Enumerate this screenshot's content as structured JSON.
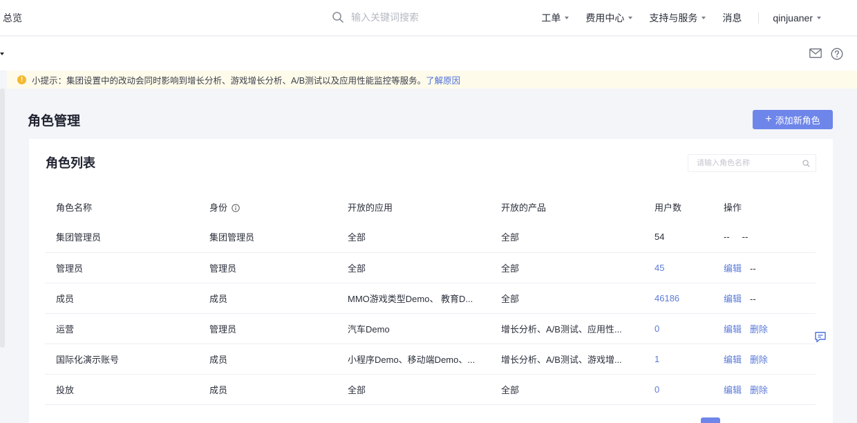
{
  "topbar": {
    "title": "总览",
    "search_placeholder": "输入关键词搜索",
    "nav": [
      {
        "label": "工单"
      },
      {
        "label": "费用中心"
      },
      {
        "label": "支持与服务"
      },
      {
        "label": "消息"
      }
    ],
    "user": "qinjuaner"
  },
  "notice": {
    "icon": "warning-icon",
    "text": "小提示：集团设置中的改动会同时影响到增长分析、游戏增长分析、A/B测试以及应用性能监控等服务。",
    "link": "了解原因"
  },
  "page": {
    "title": "角色管理",
    "add_button": "添加新角色"
  },
  "card": {
    "title": "角色列表",
    "search_placeholder": "请输入角色名称"
  },
  "table": {
    "headers": [
      "角色名称",
      "身份",
      "开放的应用",
      "开放的产品",
      "用户数",
      "操作"
    ],
    "rows": [
      {
        "name": "集团管理员",
        "identity": "集团管理员",
        "apps": "全部",
        "products": "全部",
        "users": "54",
        "op1": "--",
        "op2": "--"
      },
      {
        "name": "管理员",
        "identity": "管理员",
        "apps": "全部",
        "products": "全部",
        "users": "45",
        "op1": "编辑",
        "op2": "--"
      },
      {
        "name": "成员",
        "identity": "成员",
        "apps": "MMO游戏类型Demo、 教育D...",
        "products": "全部",
        "users": "46186",
        "op1": "编辑",
        "op2": "--"
      },
      {
        "name": "运营",
        "identity": "管理员",
        "apps": "汽车Demo",
        "products": "增长分析、A/B测试、应用性...",
        "users": "0",
        "op1": "编辑",
        "op2": "删除"
      },
      {
        "name": "国际化演示账号",
        "identity": "成员",
        "apps": "小程序Demo、移动端Demo、...",
        "products": "增长分析、A/B测试、游戏增...",
        "users": "1",
        "op1": "编辑",
        "op2": "删除"
      },
      {
        "name": "投放",
        "identity": "成员",
        "apps": "全部",
        "products": "全部",
        "users": "0",
        "op1": "编辑",
        "op2": "删除"
      }
    ]
  },
  "colors": {
    "accent": "#6e86ea",
    "link": "#5b7ad8",
    "notice_bg": "#fffbeb",
    "warning": "#f5b82e"
  }
}
